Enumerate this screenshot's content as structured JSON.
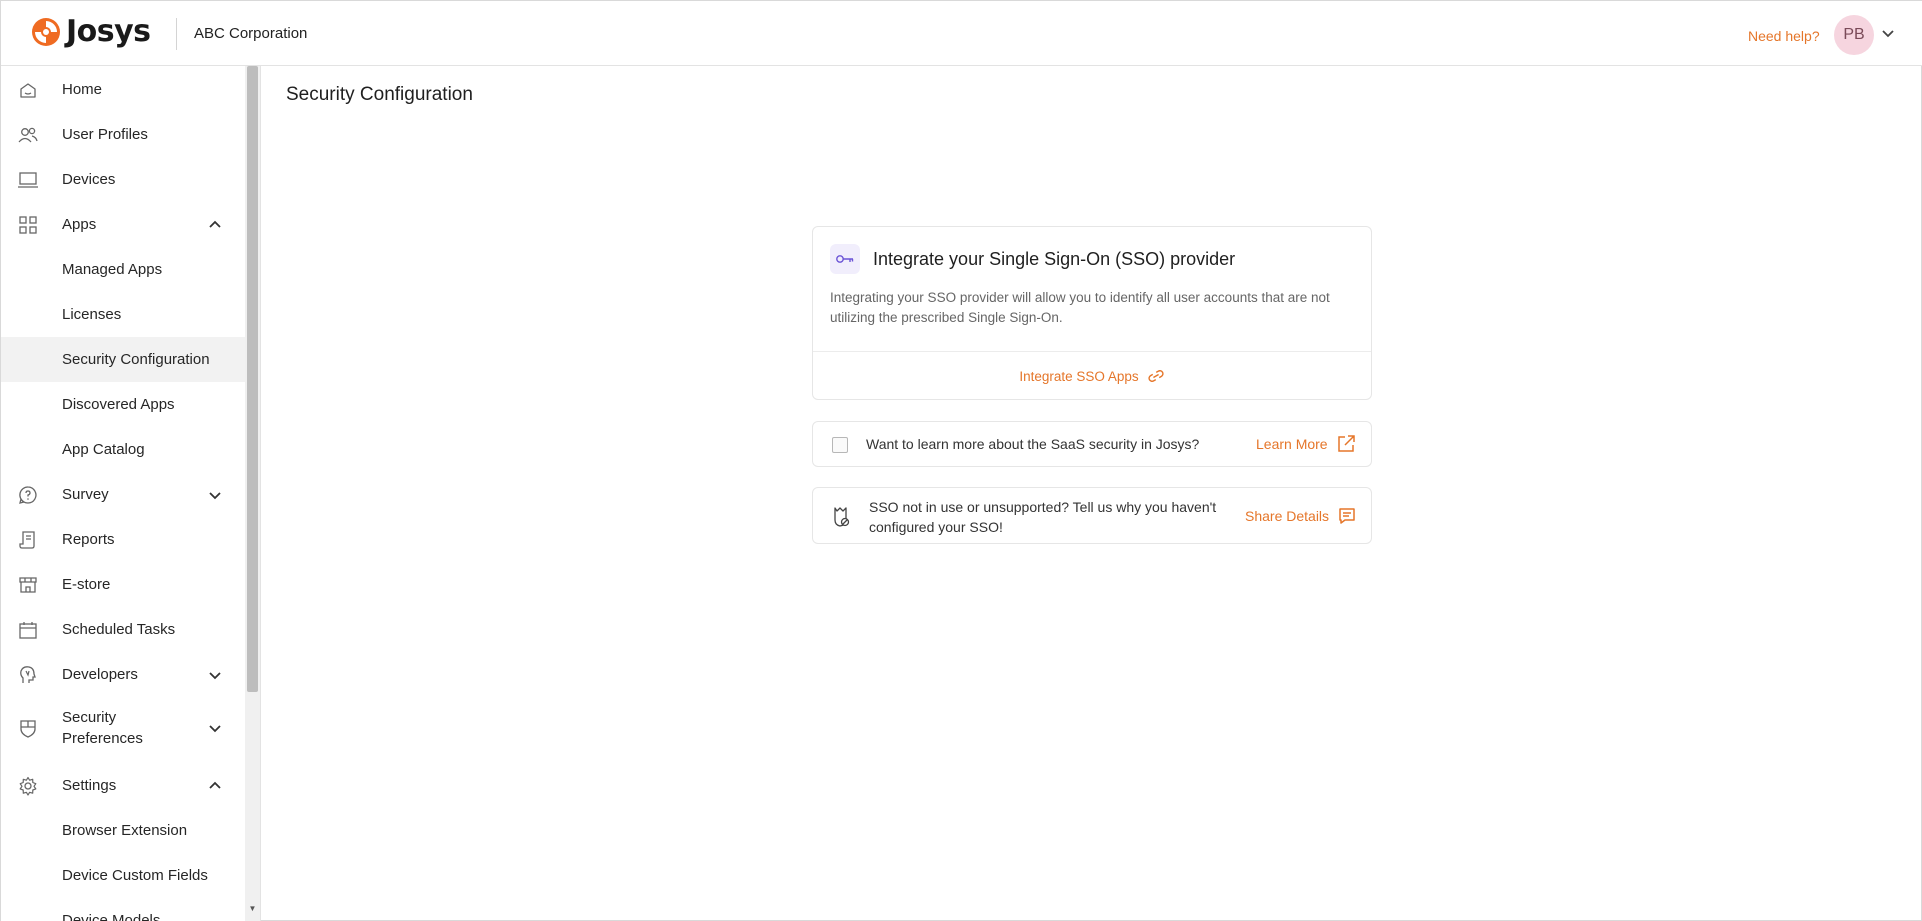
{
  "header": {
    "brand": "Josys",
    "company": "ABC Corporation",
    "need_help": "Need help?",
    "avatar_initials": "PB"
  },
  "sidebar": {
    "items": [
      {
        "label": "Home",
        "icon": "home-icon"
      },
      {
        "label": "User Profiles",
        "icon": "users-icon"
      },
      {
        "label": "Devices",
        "icon": "laptop-icon"
      },
      {
        "label": "Apps",
        "icon": "grid-icon",
        "expanded": true
      },
      {
        "label": "Managed Apps"
      },
      {
        "label": "Licenses"
      },
      {
        "label": "Security Configuration",
        "active": true
      },
      {
        "label": "Discovered Apps"
      },
      {
        "label": "App Catalog"
      },
      {
        "label": "Survey",
        "icon": "question-circle-icon",
        "expanded": false
      },
      {
        "label": "Reports",
        "icon": "report-icon"
      },
      {
        "label": "E-store",
        "icon": "store-icon"
      },
      {
        "label": "Scheduled Tasks",
        "icon": "calendar-icon"
      },
      {
        "label": "Developers",
        "icon": "developer-icon",
        "expanded": false
      },
      {
        "label": "Security Preferences",
        "icon": "shield-icon",
        "expanded": false
      },
      {
        "label": "Settings",
        "icon": "gear-icon",
        "expanded": true
      },
      {
        "label": "Browser Extension"
      },
      {
        "label": "Device Custom Fields"
      },
      {
        "label": "Device Models"
      }
    ]
  },
  "main": {
    "title": "Security Configuration",
    "sso_card": {
      "title": "Integrate your Single Sign-On (SSO) provider",
      "description": "Integrating your SSO provider will allow you to identify all user accounts that are not utilizing the prescribed Single Sign-On.",
      "action_label": "Integrate SSO Apps"
    },
    "learn_card": {
      "text": "Want to learn more about the SaaS security in Josys?",
      "link_label": "Learn More"
    },
    "share_card": {
      "text": "SSO not in use or unsupported? Tell us why you haven't configured your SSO!",
      "link_label": "Share Details"
    }
  },
  "colors": {
    "accent": "#e5762a",
    "active_bg": "#f2f2f2",
    "avatar_bg": "#f6d5df",
    "sso_icon": "#6b54d6"
  }
}
